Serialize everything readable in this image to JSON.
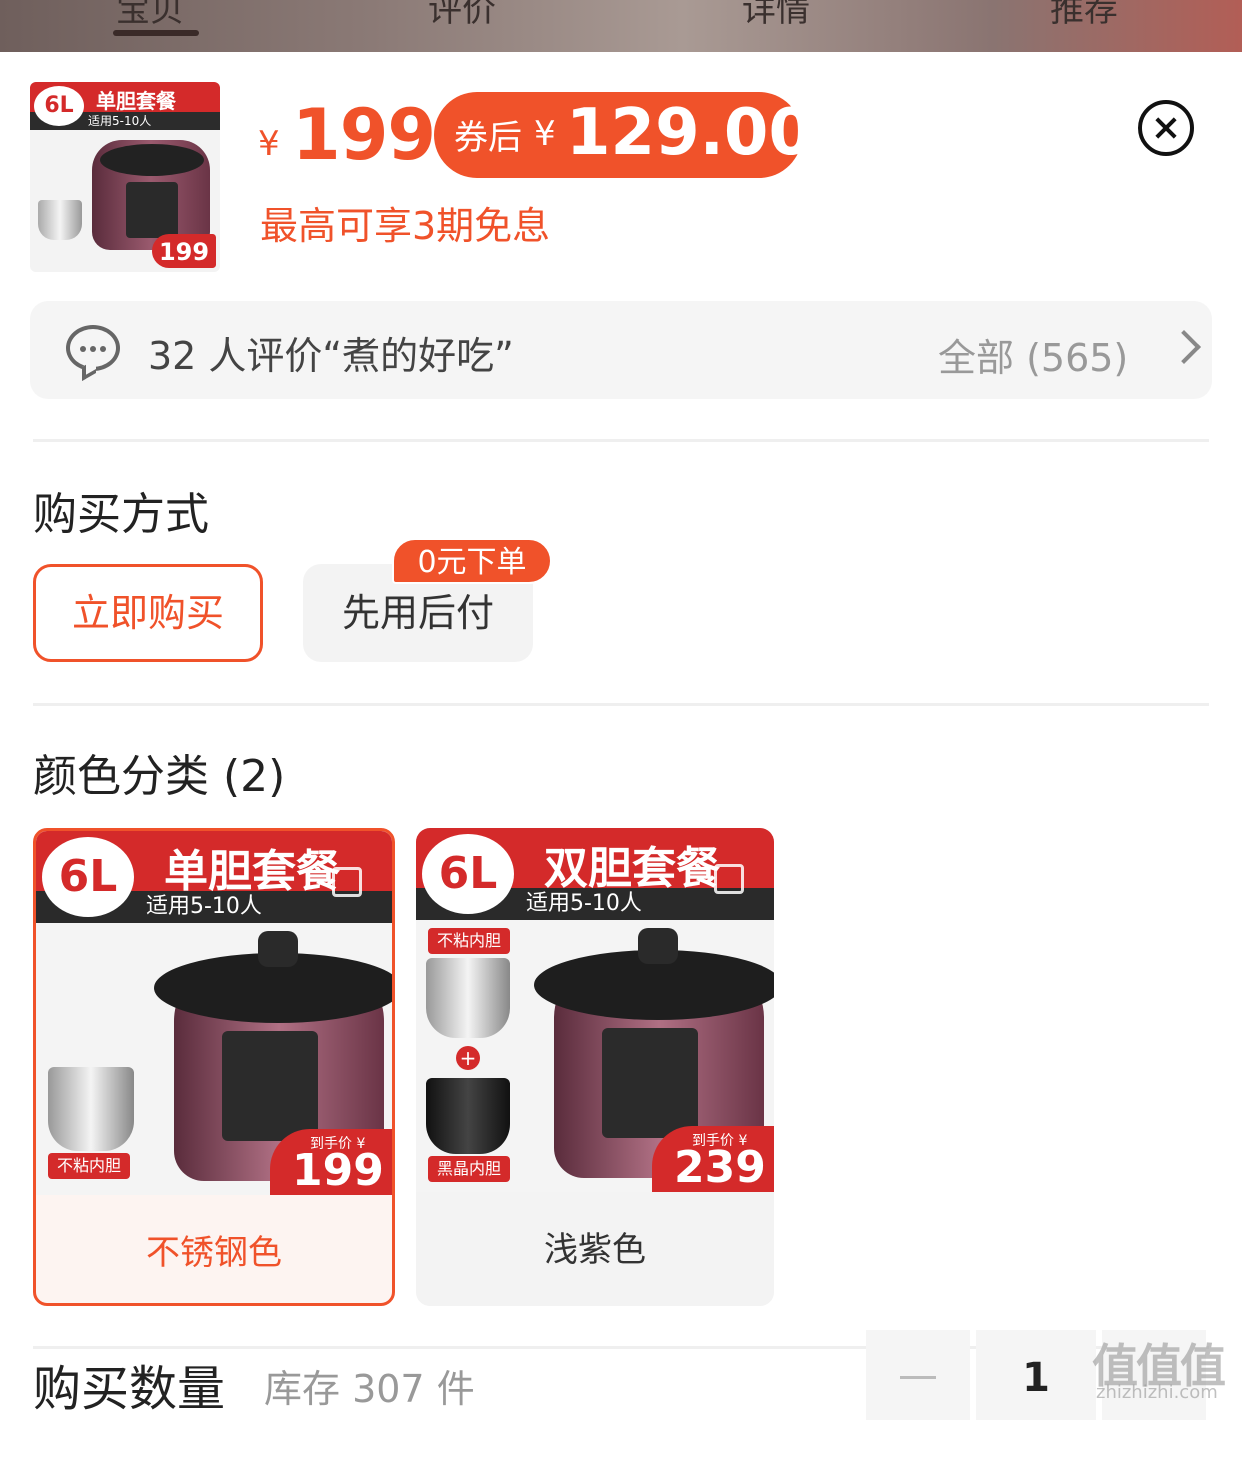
{
  "tabs": [
    {
      "label": "宝贝"
    },
    {
      "label": "评价"
    },
    {
      "label": "详情"
    },
    {
      "label": "推荐"
    }
  ],
  "header": {
    "thumb_badge": "6L",
    "thumb_title": "单胆套餐",
    "thumb_sub": "适用5-10人",
    "thumb_price": "199",
    "currency": "¥",
    "price": "199",
    "coupon_label": "券后",
    "coupon_price": "129.00",
    "installment": "最高可享3期免息"
  },
  "review": {
    "summary": "32 人评价“煮的好吃”",
    "all_label": "全部 (565)"
  },
  "purchase": {
    "title": "购买方式",
    "options": [
      {
        "label": "立即购买"
      },
      {
        "label": "先用后付"
      }
    ],
    "tag": "0元下单"
  },
  "color": {
    "title": "颜色分类 (2)",
    "items": [
      {
        "badge": "6L",
        "banner": "单胆套餐",
        "sub": "适用5-10人",
        "liner_label": "不粘内胆",
        "price_small": "到手价 ¥",
        "price": "199",
        "name": "不锈钢色"
      },
      {
        "badge": "6L",
        "banner": "双胆套餐",
        "sub": "适用5-10人",
        "liner_label": "不粘内胆",
        "liner_label2": "黑晶内胆",
        "price_small": "到手价 ¥",
        "price": "239",
        "name": "浅紫色"
      }
    ]
  },
  "quantity": {
    "title": "购买数量",
    "stock": "库存 307 件",
    "value": "1"
  },
  "watermark": {
    "main": "值值值",
    "url": "zhizhizhi.com"
  },
  "colors": {
    "accent": "#f0522a",
    "banner_red": "#d42a2a"
  }
}
